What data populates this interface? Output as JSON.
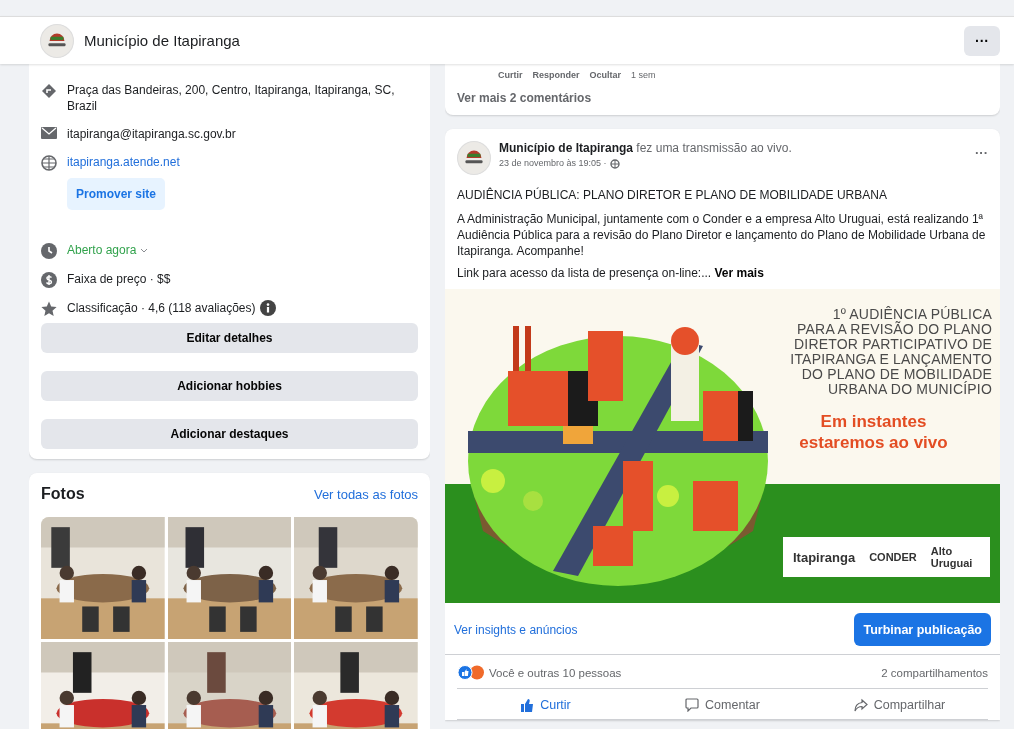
{
  "header": {
    "page_name": "Município de Itapiranga",
    "menu_button": "···"
  },
  "about": {
    "items": [
      {
        "kind": "address",
        "text": "Praça das Bandeiras, 200, Centro, Itapiranga, Itapiranga, SC, Brazil"
      },
      {
        "kind": "email",
        "text": "itapiranga@itapiranga.sc.gov.br"
      },
      {
        "kind": "website",
        "text": "itapiranga.atende.net",
        "button": "Promover site"
      },
      {
        "kind": "hours",
        "text": "Aberto agora"
      },
      {
        "kind": "price",
        "text": "Faixa de preço · $$"
      },
      {
        "kind": "rating",
        "text": "Classificação · 4,6 (118 avaliações)"
      }
    ],
    "buttons": [
      "Editar detalhes",
      "Adicionar hobbies",
      "Adicionar destaques"
    ]
  },
  "photos": {
    "title": "Fotos",
    "link": "Ver todas as fotos"
  },
  "previous_post": {
    "comment_actions": [
      "Curtir",
      "Responder",
      "Ocultar",
      "1 sem"
    ],
    "more_comments": "Ver mais 2 comentários"
  },
  "post": {
    "author": "Município de Itapiranga",
    "action": "fez uma transmissão ao vivo.",
    "date": "23 de novembro às 19:05 ·",
    "menu": "···",
    "heading": "AUDIÊNCIA PÚBLICA: PLANO DIRETOR E PLANO DE MOBILIDADE URBANA",
    "body": "A Administração Municipal, juntamente com o Conder e a empresa Alto Uruguai, está realizando 1ª Audiência Pública para a revisão do Plano Diretor e lançamento do Plano de Mobilidade Urbana de Itapiranga. Acompanhe!",
    "link_text": "Link para acesso da lista de presença on-line:...",
    "see_more": "Ver mais",
    "image": {
      "headline": [
        "1º AUDIÊNCIA PÚBLICA",
        "PARA A REVISÃO DO PLANO",
        "DIRETOR PARTICIPATIVO DE",
        "ITAPIRANGA E LANÇAMENTO",
        "DO PLANO DE MOBILIDADE",
        "URBANA DO MUNICÍPIO"
      ],
      "subline": [
        "Em instantes",
        "estaremos ao vivo"
      ],
      "logos": [
        "Itapiranga",
        "CONDER",
        "Alto Uruguai"
      ]
    },
    "insights": "Ver insights e anúncios",
    "boost": "Turbinar publicação",
    "reactions": "Você e outras 10 pessoas",
    "shares": "2 compartilhamentos",
    "liked": true,
    "actions": [
      {
        "kind": "like",
        "label": "Curtir"
      },
      {
        "kind": "comment",
        "label": "Comentar"
      },
      {
        "kind": "share",
        "label": "Compartilhar"
      }
    ]
  }
}
